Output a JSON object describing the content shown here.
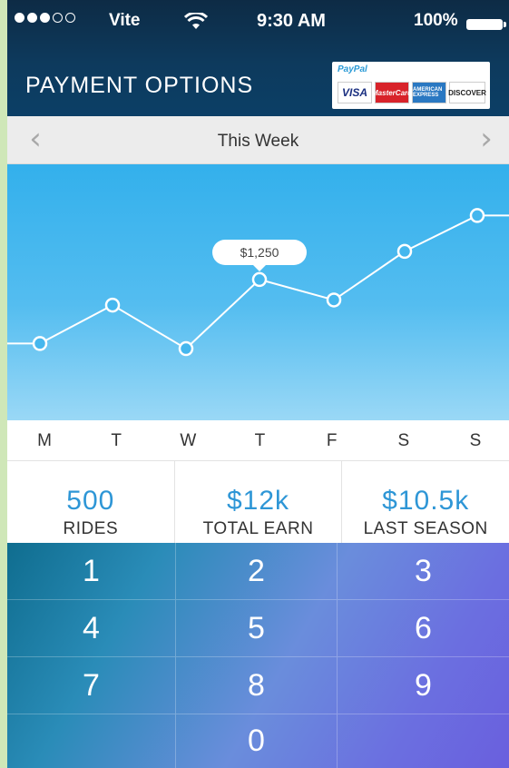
{
  "status_bar": {
    "signal_dots": [
      true,
      true,
      true,
      false,
      false
    ],
    "carrier": "Vite",
    "time": "9:30 AM",
    "battery": "100%"
  },
  "header": {
    "title": "PAYMENT OPTIONS",
    "logos": {
      "paypal": "PayPal",
      "visa": "VISA",
      "mastercard": "MasterCard",
      "amex": "AMERICAN EXPRESS",
      "discover": "DISCOVER"
    }
  },
  "week_nav": {
    "label": "This Week",
    "prev_icon": "chevron-left-icon",
    "next_icon": "chevron-right-icon"
  },
  "chart_data": {
    "type": "line",
    "categories": [
      "M",
      "T",
      "W",
      "T",
      "F",
      "S",
      "S"
    ],
    "values": [
      1000,
      1150,
      980,
      1250,
      1170,
      1360,
      1500
    ],
    "highlight": {
      "index": 3,
      "label": "$1,250"
    },
    "ylim": [
      700,
      1700
    ],
    "grid": false,
    "line_color": "#ffffff",
    "marker_fill": "#45b7ee"
  },
  "stats": [
    {
      "value": "500",
      "label": "RIDES"
    },
    {
      "value": "$12k",
      "label": "TOTAL EARN"
    },
    {
      "value": "$10.5k",
      "label": "LAST SEASON"
    }
  ],
  "keypad": {
    "keys": [
      "1",
      "2",
      "3",
      "4",
      "5",
      "6",
      "7",
      "8",
      "9",
      "",
      "0",
      ""
    ]
  },
  "colors": {
    "accent_blue": "#2e96d6",
    "header_bg": "#0d3a5d"
  }
}
